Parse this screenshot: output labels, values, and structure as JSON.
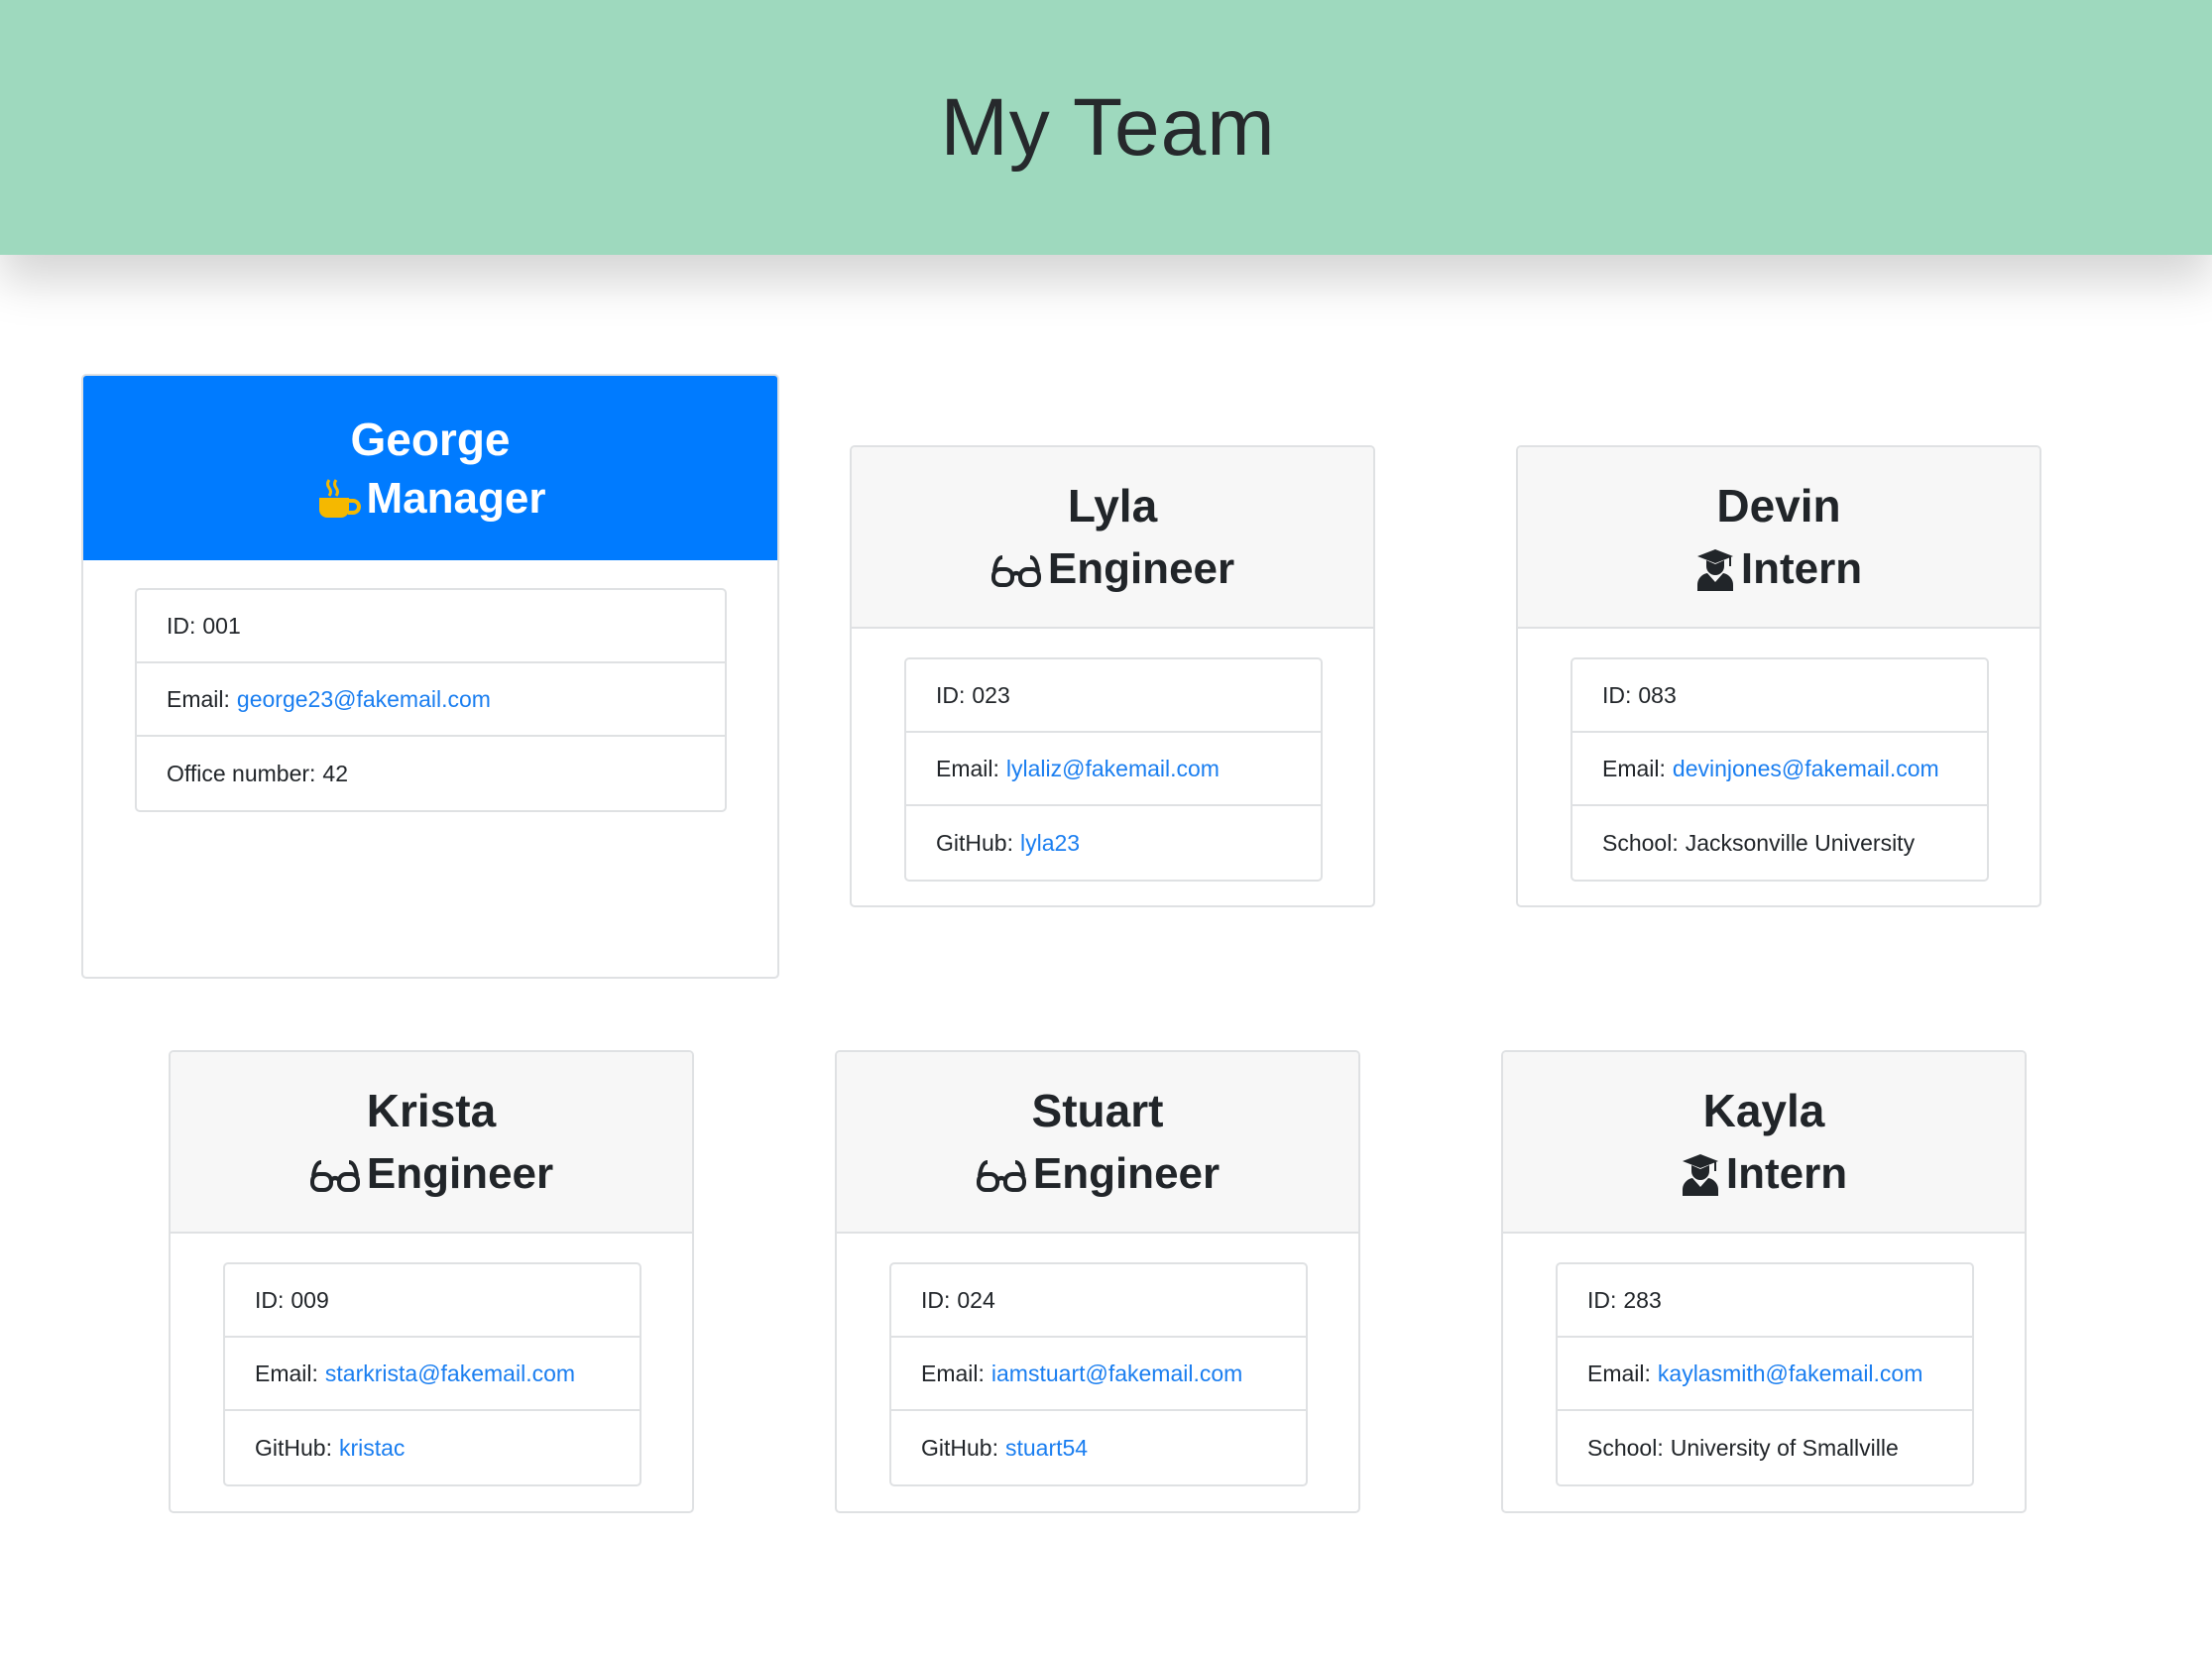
{
  "header": {
    "title": "My Team"
  },
  "colors": {
    "header_bg": "#9ed9be",
    "manager_header_bg": "#007bff",
    "link": "#1a7ef0",
    "coffee": "#f5b800"
  },
  "employees": [
    {
      "name": "George",
      "role": "Manager",
      "icon": "coffee-icon",
      "id_label": "ID:",
      "id": "001",
      "email_label": "Email:",
      "email": "george23@fakemail.com",
      "extra_label": "Office number:",
      "extra": "42"
    },
    {
      "name": "Lyla",
      "role": "Engineer",
      "icon": "glasses-icon",
      "id_label": "ID:",
      "id": "023",
      "email_label": "Email:",
      "email": "lylaliz@fakemail.com",
      "extra_label": "GitHub:",
      "extra": "lyla23"
    },
    {
      "name": "Devin",
      "role": "Intern",
      "icon": "graduate-icon",
      "id_label": "ID:",
      "id": "083",
      "email_label": "Email:",
      "email": "devinjones@fakemail.com",
      "extra_label": "School:",
      "extra": "Jacksonville University"
    },
    {
      "name": "Krista",
      "role": "Engineer",
      "icon": "glasses-icon",
      "id_label": "ID:",
      "id": "009",
      "email_label": "Email:",
      "email": "starkrista@fakemail.com",
      "extra_label": "GitHub:",
      "extra": "kristac"
    },
    {
      "name": "Stuart",
      "role": "Engineer",
      "icon": "glasses-icon",
      "id_label": "ID:",
      "id": "024",
      "email_label": "Email:",
      "email": "iamstuart@fakemail.com",
      "extra_label": "GitHub:",
      "extra": "stuart54"
    },
    {
      "name": "Kayla",
      "role": "Intern",
      "icon": "graduate-icon",
      "id_label": "ID:",
      "id": "283",
      "email_label": "Email:",
      "email": "kaylasmith@fakemail.com",
      "extra_label": "School:",
      "extra": "University of Smallville"
    }
  ]
}
